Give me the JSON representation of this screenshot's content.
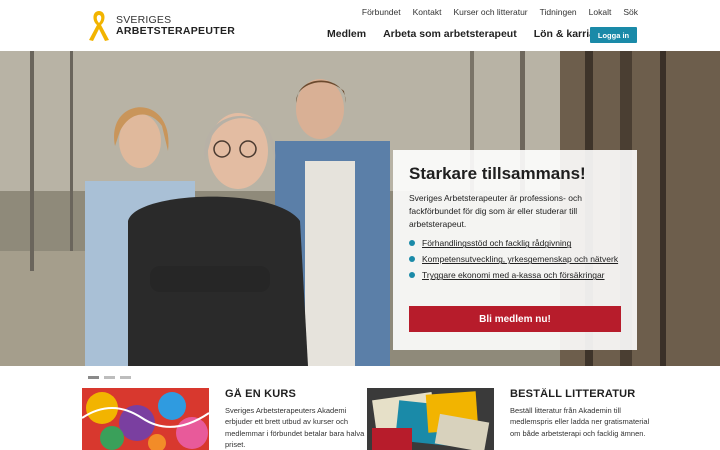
{
  "header": {
    "logo_line1": "SVERIGES",
    "logo_line2": "ARBETSTERAPEUTER",
    "topnav": [
      "Förbundet",
      "Kontakt",
      "Kurser och litteratur",
      "Tidningen",
      "Lokalt",
      "Sök"
    ],
    "mainnav": [
      "Medlem",
      "Arbeta som arbetsterapeut",
      "Lön & karriär"
    ],
    "login_label": "Logga in"
  },
  "hero": {
    "title": "Starkare tillsammans!",
    "text": "Sveriges Arbetsterapeuter är professions- och fackförbundet för dig som är eller studerar till arbetsterapeut.",
    "bullets": [
      "Förhandlingsstöd och facklig rådgivning",
      "Kompetensutveckling, yrkesgemenskap och nätverk",
      "Tryggare ekonomi med a-kassa och försäkringar"
    ],
    "cta_label": "Bli medlem nu!"
  },
  "carousel": {
    "count": 3,
    "active": 1
  },
  "cards": [
    {
      "title": "GÅ EN KURS",
      "text": "Sveriges Arbetsterapeuters Akademi erbjuder ett brett utbud av kurser och medlemmar i förbundet betalar bara halva priset."
    },
    {
      "title": "BESTÄLL LITTERATUR",
      "text": "Beställ litteratur från Akademin till medlemspris eller ladda ner gratismaterial om både arbetsterapi och facklig ämnen."
    }
  ],
  "colors": {
    "accent": "#1a8aa8",
    "cta": "#b71c2b",
    "logo_ribbon": "#f2b400"
  }
}
